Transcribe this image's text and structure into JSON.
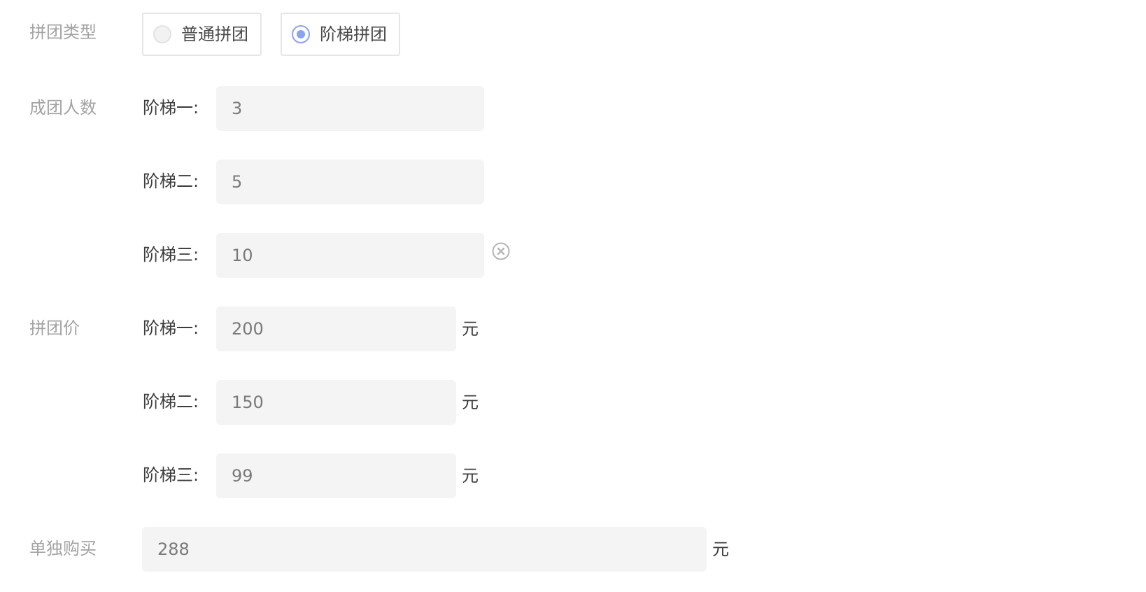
{
  "group_type": {
    "label": "拼团类型",
    "options": [
      {
        "label": "普通拼团",
        "checked": false
      },
      {
        "label": "阶梯拼团",
        "checked": true
      }
    ]
  },
  "group_size": {
    "label": "成团人数",
    "tiers": [
      {
        "label": "阶梯一:",
        "value": "3"
      },
      {
        "label": "阶梯二:",
        "value": "5"
      },
      {
        "label": "阶梯三:",
        "value": "10"
      }
    ]
  },
  "group_price": {
    "label": "拼团价",
    "unit": "元",
    "tiers": [
      {
        "label": "阶梯一:",
        "value": "200"
      },
      {
        "label": "阶梯二:",
        "value": "150"
      },
      {
        "label": "阶梯三:",
        "value": "99"
      }
    ]
  },
  "single_purchase": {
    "label": "单独购买",
    "value": "288",
    "unit": "元"
  },
  "colors": {
    "accent": "#8aa3ee",
    "muted_label": "#a3a3a3",
    "field_bg": "#f4f4f4"
  },
  "icons": {
    "clear": "circle-x-icon"
  }
}
